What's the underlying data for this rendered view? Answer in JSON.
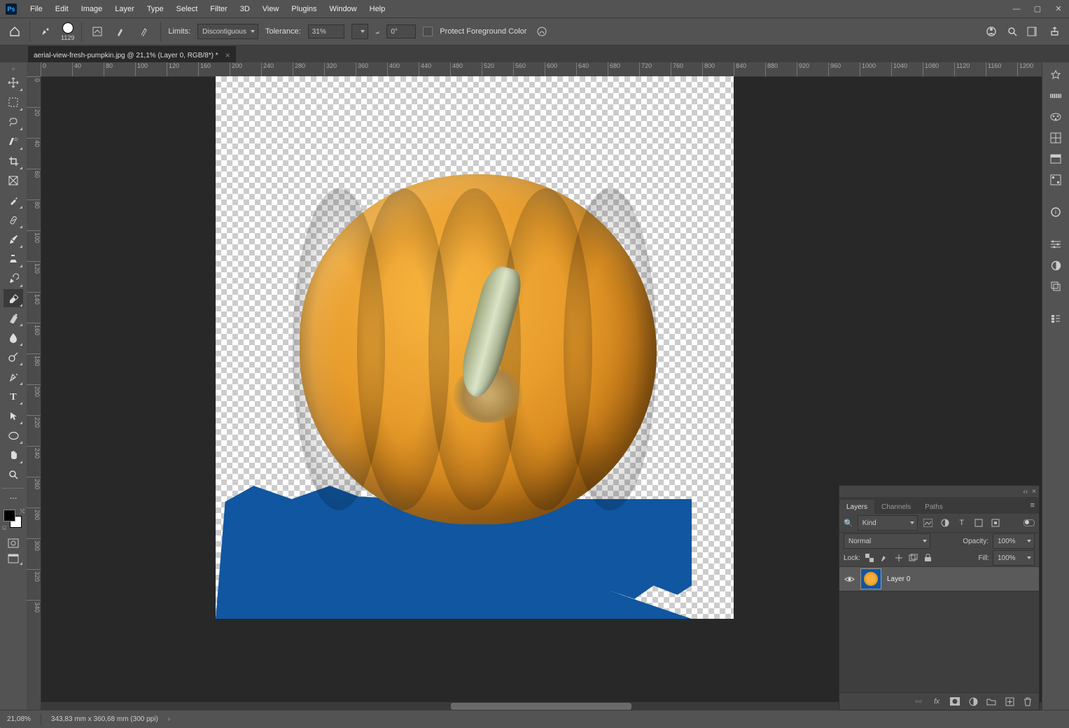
{
  "menus": [
    "File",
    "Edit",
    "Image",
    "Layer",
    "Type",
    "Select",
    "Filter",
    "3D",
    "View",
    "Plugins",
    "Window",
    "Help"
  ],
  "options": {
    "brush_size": "1129",
    "limits_label": "Limits:",
    "limits_value": "Discontiguous",
    "tolerance_label": "Tolerance:",
    "tolerance_value": "31%",
    "angle_value": "0°",
    "protect_fg_label": "Protect Foreground Color"
  },
  "document_tab": "aerial-view-fresh-pumpkin.jpg @ 21,1% (Layer 0, RGB/8*) *",
  "ruler_h": [
    "0",
    "40",
    "80",
    "100",
    "120",
    "160",
    "200",
    "240",
    "280",
    "320",
    "360",
    "400",
    "440"
  ],
  "ruler_v": [
    "0",
    "20",
    "40",
    "60",
    "80",
    "100",
    "120",
    "140",
    "160",
    "180",
    "200",
    "220",
    "240",
    "260",
    "280",
    "300",
    "320",
    "340"
  ],
  "layers_panel": {
    "tabs": [
      "Layers",
      "Channels",
      "Paths"
    ],
    "kind_label": "Kind",
    "blend_mode": "Normal",
    "opacity_label": "Opacity:",
    "opacity_value": "100%",
    "lock_label": "Lock:",
    "fill_label": "Fill:",
    "fill_value": "100%",
    "layer_name": "Layer 0"
  },
  "status": {
    "zoom": "21,08%",
    "dims": "343,83 mm x 360,68 mm (300 ppi)"
  }
}
